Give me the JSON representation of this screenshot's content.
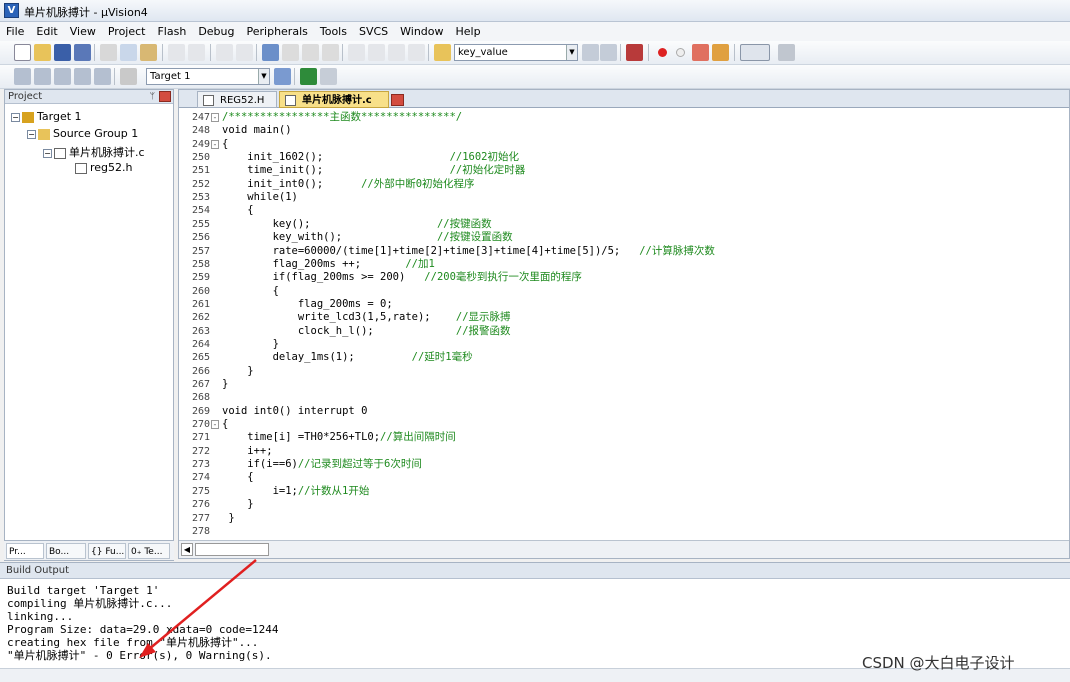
{
  "window": {
    "title": "单片机脉搏计 - µVision4"
  },
  "menu": [
    "File",
    "Edit",
    "View",
    "Project",
    "Flash",
    "Debug",
    "Peripherals",
    "Tools",
    "SVCS",
    "Window",
    "Help"
  ],
  "toolbar": {
    "find_combo": "key_value",
    "target_combo": "Target 1"
  },
  "project": {
    "header": "Project",
    "pin": "ᛘ",
    "tree": [
      {
        "label": "Target 1",
        "level": 0,
        "icon": "target-icon"
      },
      {
        "label": "Source Group 1",
        "level": 1,
        "icon": "folder-icon"
      },
      {
        "label": "单片机脉搏计.c",
        "level": 2,
        "icon": "file-c-icon"
      },
      {
        "label": "reg52.h",
        "level": 3,
        "icon": "file-h-icon"
      }
    ],
    "tabs": [
      "Pr...",
      "Bo...",
      "{} Fu...",
      "0₊ Te..."
    ]
  },
  "editor": {
    "tabs": [
      {
        "label": "REG52.H",
        "active": false
      },
      {
        "label": "单片机脉搏计.c",
        "active": true
      }
    ],
    "lines": [
      {
        "n": "247",
        "fold": "-",
        "code": "/****************主函数***************/",
        "cls": "cmt"
      },
      {
        "n": "248",
        "fold": "",
        "code": "void main()",
        "cls": "kw"
      },
      {
        "n": "249",
        "fold": "-",
        "code": "{",
        "cls": "kw"
      },
      {
        "n": "250",
        "fold": "",
        "code": "    init_1602();                    //1602初始化",
        "cls": "mix"
      },
      {
        "n": "251",
        "fold": "",
        "code": "    time_init();                    //初始化定时器",
        "cls": "mix"
      },
      {
        "n": "252",
        "fold": "",
        "code": "    init_int0();      //外部中断0初始化程序",
        "cls": "mix"
      },
      {
        "n": "253",
        "fold": "",
        "code": "    while(1)",
        "cls": "kw"
      },
      {
        "n": "254",
        "fold": "",
        "code": "    {",
        "cls": "kw"
      },
      {
        "n": "255",
        "fold": "",
        "code": "        key();                    //按键函数",
        "cls": "mix"
      },
      {
        "n": "256",
        "fold": "",
        "code": "        key_with();               //按键设置函数",
        "cls": "mix"
      },
      {
        "n": "257",
        "fold": "",
        "code": "        rate=60000/(time[1]+time[2]+time[3]+time[4]+time[5])/5;   //计算脉搏次数",
        "cls": "mix"
      },
      {
        "n": "258",
        "fold": "",
        "code": "        flag_200ms ++;       //加1",
        "cls": "mix"
      },
      {
        "n": "259",
        "fold": "",
        "code": "        if(flag_200ms >= 200)   //200毫秒到执行一次里面的程序",
        "cls": "mix"
      },
      {
        "n": "260",
        "fold": "",
        "code": "        {",
        "cls": "kw"
      },
      {
        "n": "261",
        "fold": "",
        "code": "            flag_200ms = 0;",
        "cls": "kw"
      },
      {
        "n": "262",
        "fold": "",
        "code": "            write_lcd3(1,5,rate);    //显示脉搏",
        "cls": "mix"
      },
      {
        "n": "263",
        "fold": "",
        "code": "            clock_h_l();             //报警函数",
        "cls": "mix"
      },
      {
        "n": "264",
        "fold": "",
        "code": "        }",
        "cls": "kw"
      },
      {
        "n": "265",
        "fold": "",
        "code": "        delay_1ms(1);         //延时1毫秒",
        "cls": "mix"
      },
      {
        "n": "266",
        "fold": "",
        "code": "    }",
        "cls": "kw"
      },
      {
        "n": "267",
        "fold": "",
        "code": "}",
        "cls": "kw"
      },
      {
        "n": "268",
        "fold": "",
        "code": "",
        "cls": "kw"
      },
      {
        "n": "269",
        "fold": "",
        "code": "void int0() interrupt 0",
        "cls": "kw"
      },
      {
        "n": "270",
        "fold": "-",
        "code": "{",
        "cls": "kw"
      },
      {
        "n": "271",
        "fold": "",
        "code": "    time[i] =TH0*256+TL0;//算出间隔时间",
        "cls": "mix"
      },
      {
        "n": "272",
        "fold": "",
        "code": "    i++;",
        "cls": "kw"
      },
      {
        "n": "273",
        "fold": "",
        "code": "    if(i==6)//记录到超过等于6次时间",
        "cls": "mix"
      },
      {
        "n": "274",
        "fold": "",
        "code": "    {",
        "cls": "kw"
      },
      {
        "n": "275",
        "fold": "",
        "code": "        i=1;//计数从1开始",
        "cls": "mix"
      },
      {
        "n": "276",
        "fold": "",
        "code": "    }",
        "cls": "kw"
      },
      {
        "n": "277",
        "fold": "",
        "code": " }",
        "cls": "kw"
      },
      {
        "n": "278",
        "fold": "",
        "code": "",
        "cls": "kw"
      }
    ]
  },
  "build_output": {
    "header": "Build Output",
    "lines": [
      "Build target 'Target 1'",
      "compiling 单片机脉搏计.c...",
      "linking...",
      "Program Size: data=29.0 xdata=0 code=1244",
      "creating hex file from \"单片机脉搏计\"...",
      "\"单片机脉搏计\" - 0 Error(s), 0 Warning(s)."
    ]
  },
  "watermark": "CSDN @大白电子设计",
  "colors": {
    "comment": "#1e8a1e",
    "arrow": "#e02020",
    "accent": "#2b63b8"
  }
}
